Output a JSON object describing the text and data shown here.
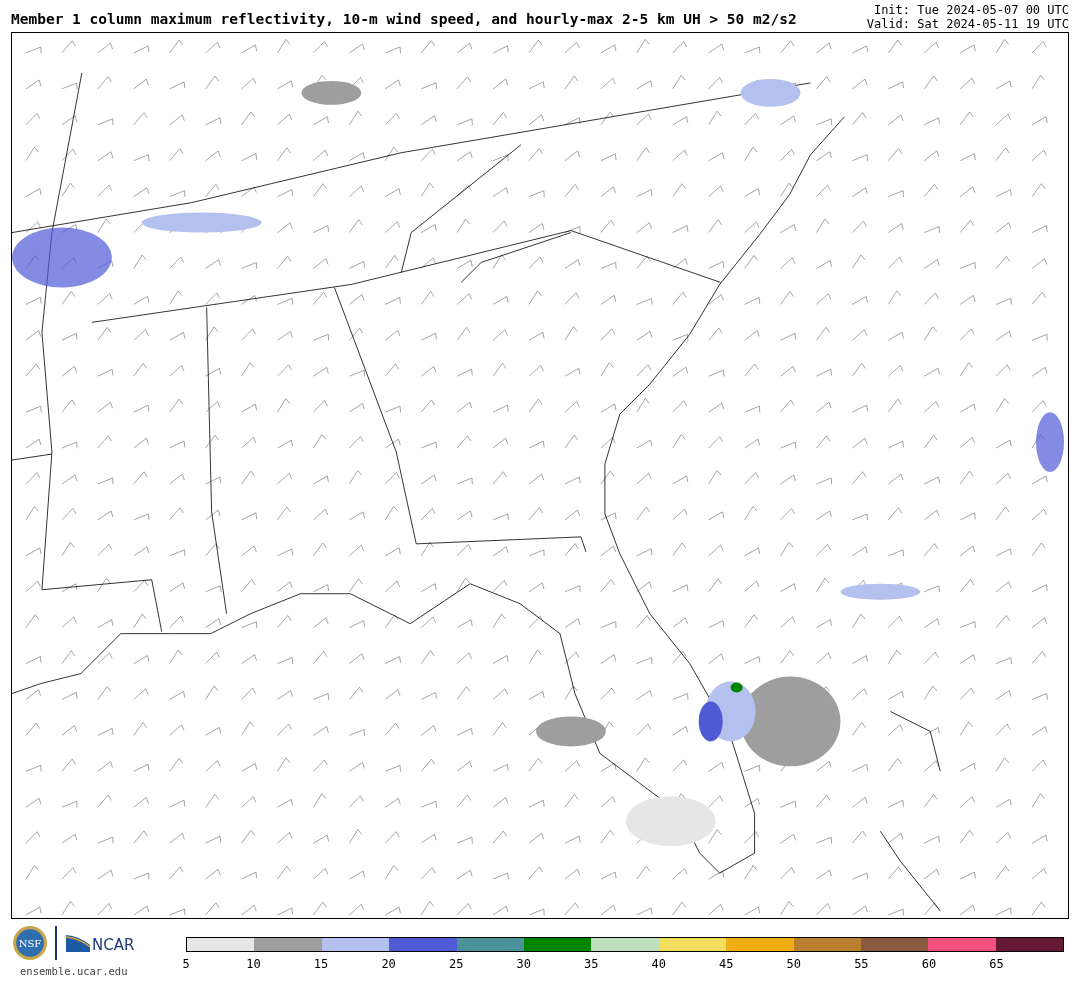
{
  "title": "Member 1 column maximum reflectivity, 10-m wind speed, and hourly-max 2-5 km UH > 50 m2/s2",
  "init": "Init: Tue 2024-05-07 00 UTC",
  "valid": "Valid: Sat 2024-05-11 19 UTC",
  "logos": {
    "seal_text": "NSF",
    "org_text": "NCAR",
    "site": "ensemble.ucar.edu"
  },
  "colorbar": {
    "segments": [
      {
        "color": "#e6e6e6"
      },
      {
        "color": "#9e9e9e"
      },
      {
        "color": "#b4c0ee"
      },
      {
        "color": "#4f5bd5"
      },
      {
        "color": "#4a939a"
      },
      {
        "color": "#008500"
      },
      {
        "color": "#bfdfbf"
      },
      {
        "color": "#f2dd5e"
      },
      {
        "color": "#f0ae13"
      },
      {
        "color": "#b8802f"
      },
      {
        "color": "#8a5a3e"
      },
      {
        "color": "#f4527e"
      },
      {
        "color": "#641a35"
      }
    ],
    "ticks": [
      "5",
      "10",
      "15",
      "20",
      "25",
      "30",
      "35",
      "40",
      "45",
      "50",
      "55",
      "60",
      "65"
    ]
  }
}
